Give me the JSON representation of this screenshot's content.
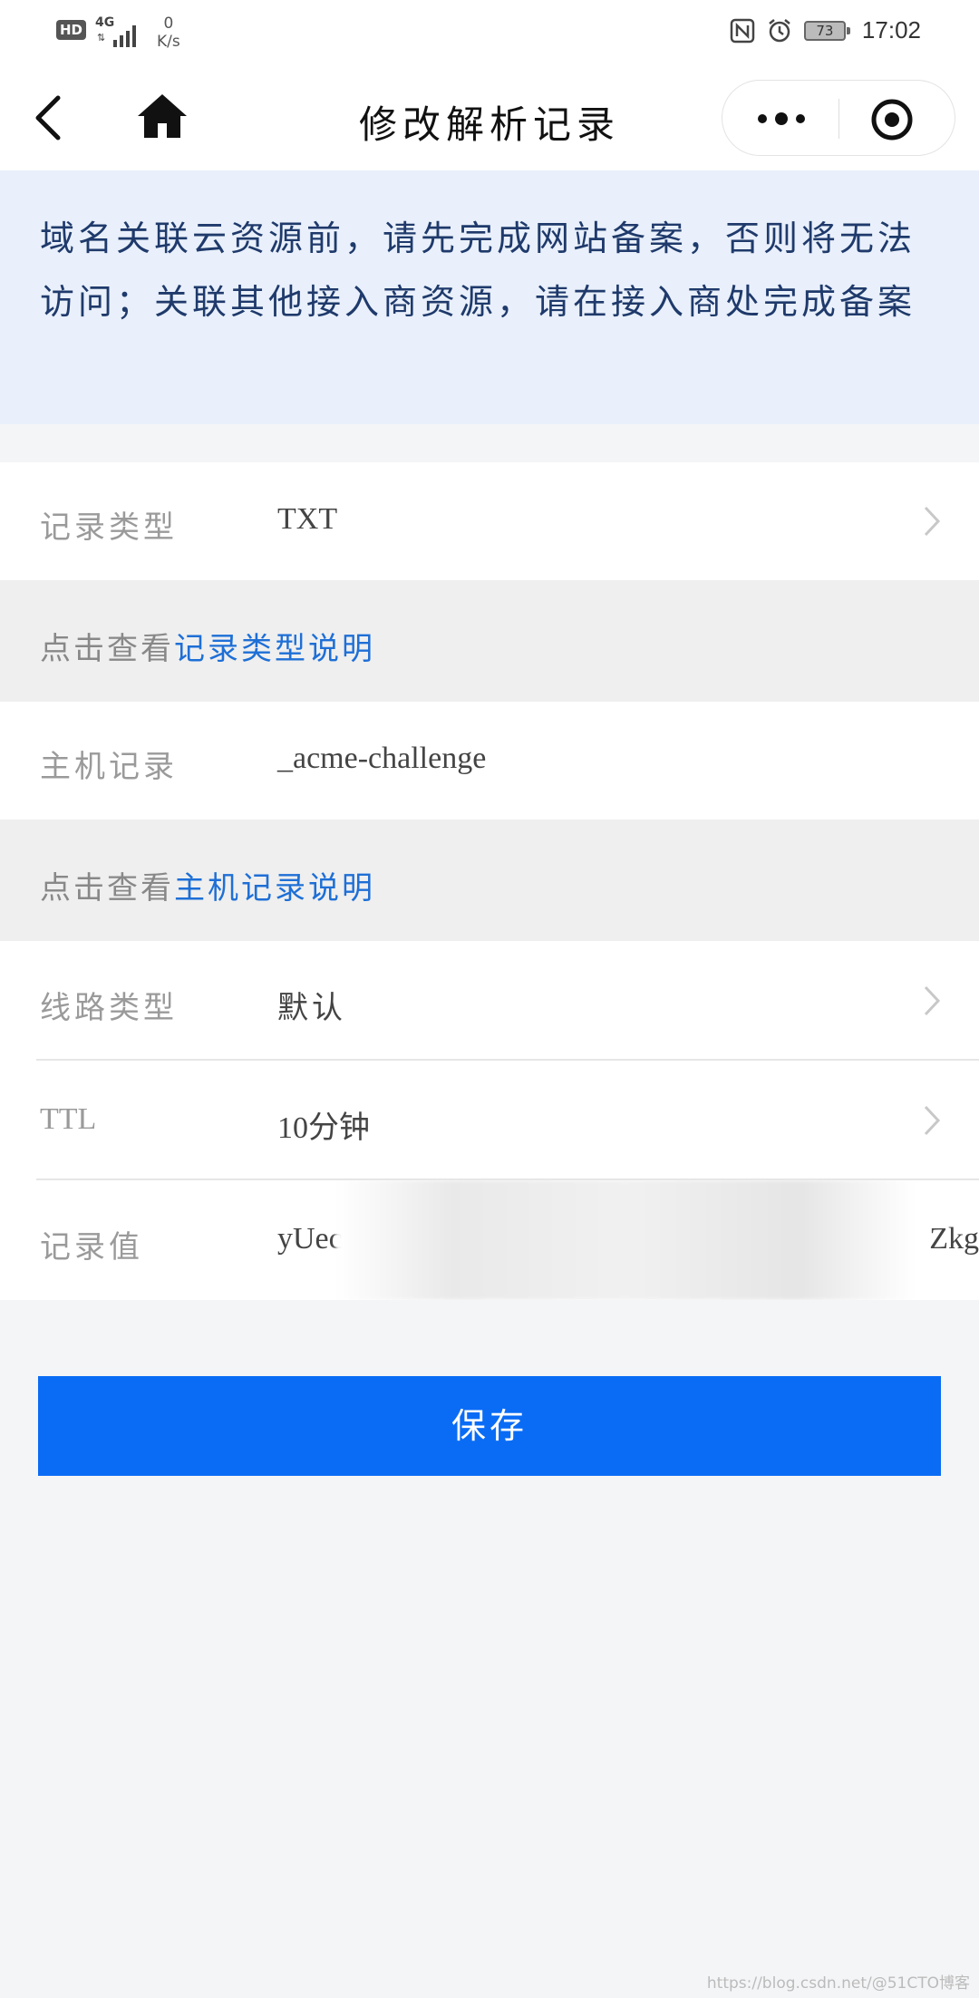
{
  "status_bar": {
    "hd": "HD",
    "network": "4G",
    "speed_value": "0",
    "speed_unit": "K/s",
    "battery": "73",
    "time": "17:02"
  },
  "nav": {
    "title": "修改解析记录"
  },
  "notice": {
    "text": "域名关联云资源前，请先完成网站备案，否则将无法访问；关联其他接入商资源，请在接入商处完成备案"
  },
  "form": {
    "record_type": {
      "label": "记录类型",
      "value": "TXT"
    },
    "record_type_hint": {
      "prefix": "点击查看",
      "link": "记录类型说明"
    },
    "host": {
      "label": "主机记录",
      "value": "_acme-challenge"
    },
    "host_hint": {
      "prefix": "点击查看",
      "link": "主机记录说明"
    },
    "line_type": {
      "label": "线路类型",
      "value": "默认"
    },
    "ttl": {
      "label": "TTL",
      "value": "10分钟"
    },
    "record_value": {
      "label": "记录值",
      "value_start": "yUec",
      "value_end": "Zkg"
    }
  },
  "actions": {
    "save_label": "保存"
  },
  "watermark": "https://blog.csdn.net/@51CTO博客",
  "colors": {
    "accent": "#0a6cf5",
    "link": "#1e6fd6",
    "notice_bg": "#e9f0fb",
    "notice_text": "#1f3a6b"
  }
}
